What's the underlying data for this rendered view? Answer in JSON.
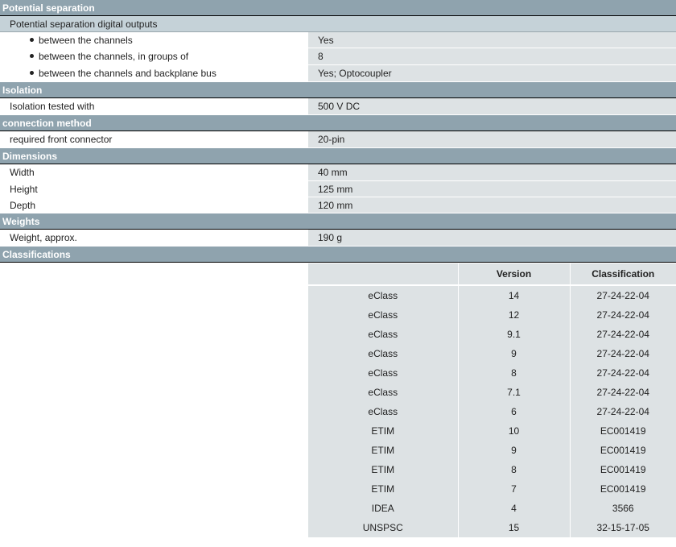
{
  "sections": {
    "potential_separation": {
      "title": "Potential separation",
      "sub": "Potential separation digital outputs",
      "rows": [
        {
          "label": "between the channels",
          "value": "Yes"
        },
        {
          "label": "between the channels, in groups of",
          "value": "8"
        },
        {
          "label": "between the channels and backplane bus",
          "value": "Yes; Optocoupler"
        }
      ]
    },
    "isolation": {
      "title": "Isolation",
      "rows": [
        {
          "label": "Isolation tested with",
          "value": "500 V DC"
        }
      ]
    },
    "connection": {
      "title": "connection method",
      "rows": [
        {
          "label": "required front connector",
          "value": "20-pin"
        }
      ]
    },
    "dimensions": {
      "title": "Dimensions",
      "rows": [
        {
          "label": "Width",
          "value": "40 mm"
        },
        {
          "label": "Height",
          "value": "125 mm"
        },
        {
          "label": "Depth",
          "value": "120 mm"
        }
      ]
    },
    "weights": {
      "title": "Weights",
      "rows": [
        {
          "label": "Weight, approx.",
          "value": "190 g"
        }
      ]
    },
    "classifications": {
      "title": "Classifications",
      "headers": [
        "",
        "Version",
        "Classification"
      ],
      "rows": [
        [
          "eClass",
          "14",
          "27-24-22-04"
        ],
        [
          "eClass",
          "12",
          "27-24-22-04"
        ],
        [
          "eClass",
          "9.1",
          "27-24-22-04"
        ],
        [
          "eClass",
          "9",
          "27-24-22-04"
        ],
        [
          "eClass",
          "8",
          "27-24-22-04"
        ],
        [
          "eClass",
          "7.1",
          "27-24-22-04"
        ],
        [
          "eClass",
          "6",
          "27-24-22-04"
        ],
        [
          "ETIM",
          "10",
          "EC001419"
        ],
        [
          "ETIM",
          "9",
          "EC001419"
        ],
        [
          "ETIM",
          "8",
          "EC001419"
        ],
        [
          "ETIM",
          "7",
          "EC001419"
        ],
        [
          "IDEA",
          "4",
          "3566"
        ],
        [
          "UNSPSC",
          "15",
          "32-15-17-05"
        ]
      ]
    }
  }
}
